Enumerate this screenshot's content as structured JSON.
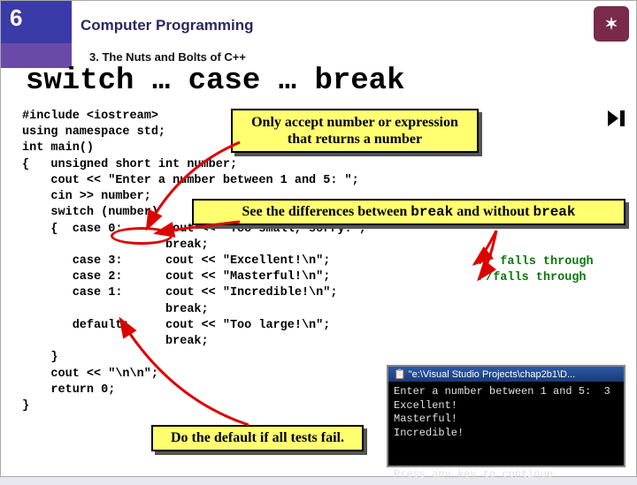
{
  "slide_number": "6",
  "header_title": "Computer Programming",
  "section_label": "3. The Nuts and Bolts of C++",
  "main_title": "switch … case … break",
  "code": "#include <iostream>\nusing namespace std;\nint main()\n{   unsigned short int number;\n    cout << \"Enter a number between 1 and 5: \";\n    cin >> number;\n    switch (number)\n    {  case 0:      cout << \"Too small, sorry!\";\n                    break;\n       case 3:      cout << \"Excellent!\\n\";\n       case 2:      cout << \"Masterful!\\n\";\n       case 1:      cout << \"Incredible!\\n\";\n                    break;\n       default:     cout << \"Too large!\\n\";\n                    break;\n    }\n    cout << \"\\n\\n\";\n    return 0;\n}",
  "callout1_line1": "Only accept number or expression",
  "callout1_line2": "that returns a number",
  "callout2_pre": "See the differences between ",
  "callout2_m1": "break",
  "callout2_mid": " and without ",
  "callout2_m2": "break",
  "callout3": "Do the default if all tests fail.",
  "comment1": "// falls through",
  "comment2": "//falls through",
  "console_title": "\"e:\\Visual Studio Projects\\chap2b1\\D...",
  "console_body": "Enter a number between 1 and 5:  3\nExcellent!\nMasterful!\nIncredible!\n\n\nPress any key to continue_",
  "logo_text": "✶"
}
